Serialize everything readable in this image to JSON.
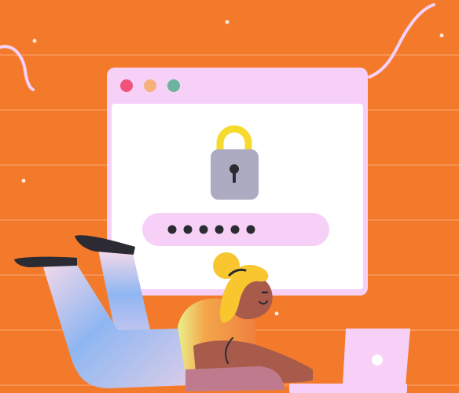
{
  "illustration": {
    "background_color": "#F47A2B",
    "accent_colors": {
      "window_frame": "#F6D0F7",
      "window_body": "#FFFFFF",
      "dot_close": "#F0527A",
      "dot_minimize": "#F6B07A",
      "dot_maximize": "#6CB39C",
      "lock_shackle": "#F7DA2E",
      "lock_body": "#ADABC2",
      "password_field": "#F6D0F7",
      "password_dots": "#2C2B33",
      "laptop": "#F6D0F7",
      "hair": "#F8C72F",
      "skin": "#A85B4A",
      "shirt": "#F3A64B",
      "pants": "#8FA8EE"
    },
    "icons": [
      "padlock-icon",
      "window-control-dots",
      "laptop",
      "person-lying-down"
    ],
    "password_mask_count": 6
  }
}
